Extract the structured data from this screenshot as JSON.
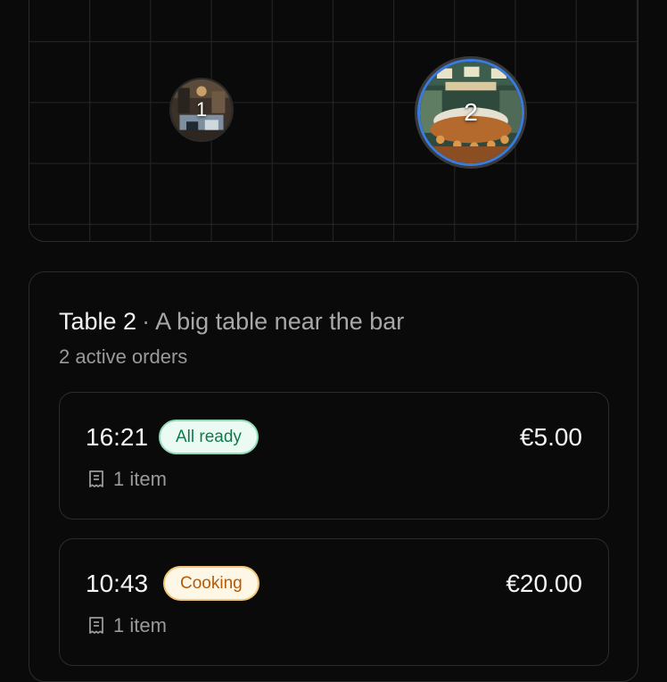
{
  "floor_plan": {
    "tables": [
      {
        "number": "1",
        "selected": false
      },
      {
        "number": "2",
        "selected": true
      }
    ]
  },
  "table_details": {
    "name": "Table 2",
    "separator": "·",
    "description": "A big table near the bar",
    "active_orders_text": "2 active orders"
  },
  "orders": [
    {
      "time": "16:21",
      "status": "All ready",
      "status_color": "#0f7a4d",
      "price": "€5.00",
      "items": "1 item",
      "icon": "receipt-icon"
    },
    {
      "time": "10:43",
      "status": "Cooking",
      "status_color": "#b25b0a",
      "price": "€20.00",
      "items": "1 item",
      "icon": "receipt-icon"
    }
  ],
  "colors": {
    "background": "#0a0a0a",
    "selected_ring": "#3a7be0"
  }
}
